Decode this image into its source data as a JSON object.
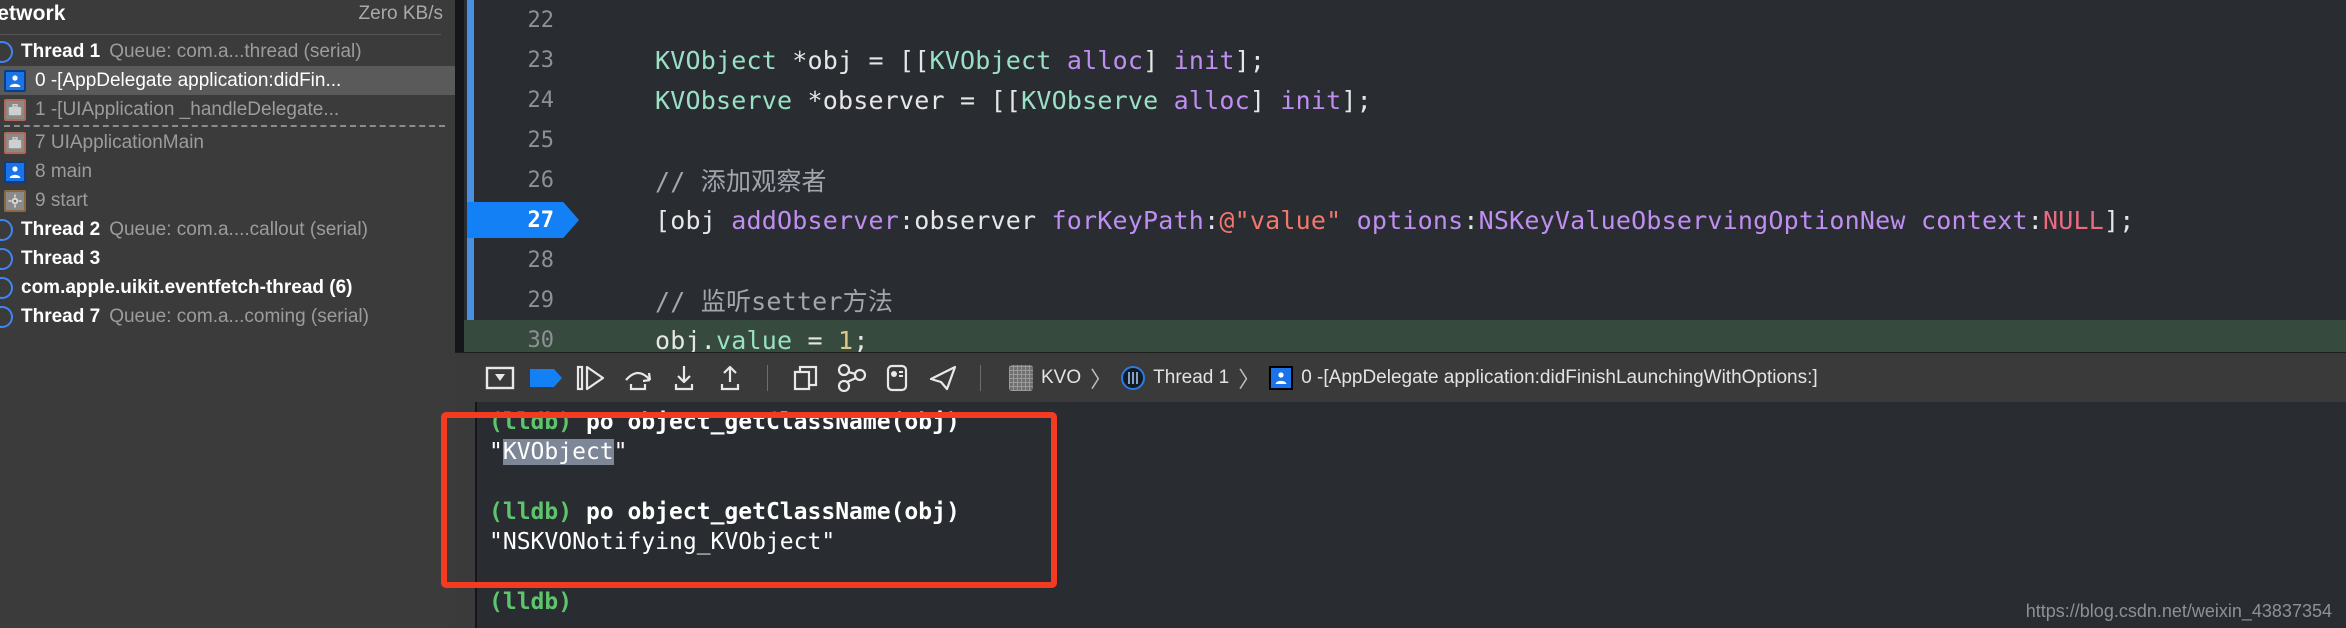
{
  "sidebar": {
    "header": {
      "title": "Network",
      "rate": "Zero KB/s"
    },
    "rows": [
      {
        "kind": "thread",
        "icon": "thread-disclosure-icon",
        "label": "Thread 1",
        "queue": "Queue: com.a...thread (serial)",
        "selected": false,
        "dashed_after": false
      },
      {
        "kind": "frame",
        "icon": "user-frame-icon",
        "label": "0 -[AppDelegate application:didFin...",
        "queue": "",
        "selected": true,
        "dashed_after": false
      },
      {
        "kind": "frame",
        "icon": "system-frame-icon",
        "label": "1 -[UIApplication _handleDelegate...",
        "queue": "",
        "selected": false,
        "dashed_after": true
      },
      {
        "kind": "frame",
        "icon": "system-frame-icon",
        "label": "7 UIApplicationMain",
        "queue": "",
        "selected": false,
        "dashed_after": false
      },
      {
        "kind": "frame",
        "icon": "user-frame-icon",
        "label": "8 main",
        "queue": "",
        "selected": false,
        "dashed_after": false
      },
      {
        "kind": "frame",
        "icon": "kernel-frame-icon",
        "label": "9 start",
        "queue": "",
        "selected": false,
        "dashed_after": false
      },
      {
        "kind": "thread",
        "icon": "thread-disclosure-icon",
        "label": "Thread 2",
        "queue": "Queue: com.a....callout (serial)",
        "selected": false,
        "dashed_after": false
      },
      {
        "kind": "thread",
        "icon": "thread-disclosure-icon",
        "label": "Thread 3",
        "queue": "",
        "selected": false,
        "dashed_after": false
      },
      {
        "kind": "thread",
        "icon": "thread-disclosure-icon",
        "label": "com.apple.uikit.eventfetch-thread (6)",
        "queue": "",
        "selected": false,
        "dashed_after": false
      },
      {
        "kind": "thread",
        "icon": "thread-disclosure-icon",
        "label": "Thread 7",
        "queue": "Queue: com.a...coming (serial)",
        "selected": false,
        "dashed_after": false
      }
    ]
  },
  "editor": {
    "lines": [
      {
        "num": "22",
        "current": false,
        "exec": false,
        "tokens": []
      },
      {
        "num": "23",
        "current": false,
        "exec": false,
        "tokens": [
          {
            "t": "    ",
            "c": "tok-plain"
          },
          {
            "t": "KVObject",
            "c": "tok-type"
          },
          {
            "t": " *obj = [[",
            "c": "tok-plain"
          },
          {
            "t": "KVObject",
            "c": "tok-type"
          },
          {
            "t": " ",
            "c": "tok-plain"
          },
          {
            "t": "alloc",
            "c": "tok-sel"
          },
          {
            "t": "] ",
            "c": "tok-plain"
          },
          {
            "t": "init",
            "c": "tok-sel"
          },
          {
            "t": "];",
            "c": "tok-plain"
          }
        ]
      },
      {
        "num": "24",
        "current": false,
        "exec": false,
        "tokens": [
          {
            "t": "    ",
            "c": "tok-plain"
          },
          {
            "t": "KVObserve",
            "c": "tok-type"
          },
          {
            "t": " *observer = [[",
            "c": "tok-plain"
          },
          {
            "t": "KVObserve",
            "c": "tok-type"
          },
          {
            "t": " ",
            "c": "tok-plain"
          },
          {
            "t": "alloc",
            "c": "tok-sel"
          },
          {
            "t": "] ",
            "c": "tok-plain"
          },
          {
            "t": "init",
            "c": "tok-sel"
          },
          {
            "t": "];",
            "c": "tok-plain"
          }
        ]
      },
      {
        "num": "25",
        "current": false,
        "exec": false,
        "tokens": []
      },
      {
        "num": "26",
        "current": false,
        "exec": false,
        "tokens": [
          {
            "t": "    // 添加观察者",
            "c": "tok-comment"
          }
        ]
      },
      {
        "num": "27",
        "current": true,
        "exec": false,
        "tokens": [
          {
            "t": "    [obj ",
            "c": "tok-plain"
          },
          {
            "t": "addObserver",
            "c": "tok-sel"
          },
          {
            "t": ":observer ",
            "c": "tok-plain"
          },
          {
            "t": "forKeyPath",
            "c": "tok-sel"
          },
          {
            "t": ":",
            "c": "tok-plain"
          },
          {
            "t": "@\"value\"",
            "c": "tok-str"
          },
          {
            "t": " ",
            "c": "tok-plain"
          },
          {
            "t": "options",
            "c": "tok-sel"
          },
          {
            "t": ":",
            "c": "tok-plain"
          },
          {
            "t": "NSKeyValueObservingOptionNew",
            "c": "tok-sel"
          },
          {
            "t": " ",
            "c": "tok-plain"
          },
          {
            "t": "context",
            "c": "tok-sel"
          },
          {
            "t": ":",
            "c": "tok-plain"
          },
          {
            "t": "NULL",
            "c": "tok-const"
          },
          {
            "t": "];",
            "c": "tok-plain"
          }
        ]
      },
      {
        "num": "28",
        "current": false,
        "exec": false,
        "tokens": []
      },
      {
        "num": "29",
        "current": false,
        "exec": false,
        "tokens": [
          {
            "t": "    // 监听setter方法",
            "c": "tok-comment"
          }
        ]
      },
      {
        "num": "30",
        "current": false,
        "exec": true,
        "tokens": [
          {
            "t": "    obj.",
            "c": "tok-plain"
          },
          {
            "t": "value",
            "c": "tok-prop"
          },
          {
            "t": " = ",
            "c": "tok-plain"
          },
          {
            "t": "1",
            "c": "tok-num"
          },
          {
            "t": ";",
            "c": "tok-plain"
          }
        ]
      }
    ]
  },
  "debug_bar": {
    "buttons": [
      {
        "name": "hide-debug-area-button",
        "icon": "hide-debug-area-icon"
      },
      {
        "name": "deactivate-breakpoints-button",
        "icon": "breakpoint-icon"
      },
      {
        "name": "continue-button",
        "icon": "continue-program-icon"
      },
      {
        "name": "step-over-button",
        "icon": "step-over-icon"
      },
      {
        "name": "step-into-button",
        "icon": "step-into-icon"
      },
      {
        "name": "step-out-button",
        "icon": "step-out-icon"
      },
      {
        "name": "debug-view-hierarchy-button",
        "icon": "view-hierarchy-icon"
      },
      {
        "name": "debug-memory-graph-button",
        "icon": "memory-graph-icon"
      },
      {
        "name": "environment-overrides-button",
        "icon": "environment-overrides-icon"
      },
      {
        "name": "simulate-location-button",
        "icon": "location-arrow-icon"
      }
    ],
    "breadcrumb": [
      {
        "icon": "project-icon",
        "label": "KVO"
      },
      {
        "icon": "thread-icon",
        "label": "Thread 1"
      },
      {
        "icon": "person-frame-icon",
        "label": "0 -[AppDelegate application:didFinishLaunchingWithOptions:]"
      }
    ]
  },
  "console": {
    "lines": [
      {
        "prompt": "(lldb)",
        "cmd": " po object_getClassName(obj)",
        "out": "",
        "sel": ""
      },
      {
        "prompt": "",
        "cmd": "",
        "out": "\"KVObject\"",
        "sel": "KVObject"
      },
      {
        "prompt": "",
        "cmd": "",
        "out": "",
        "sel": ""
      },
      {
        "prompt": "(lldb)",
        "cmd": " po object_getClassName(obj)",
        "out": "",
        "sel": ""
      },
      {
        "prompt": "",
        "cmd": "",
        "out": "\"NSKVONotifying_KVObject\"",
        "sel": ""
      },
      {
        "prompt": "",
        "cmd": "",
        "out": "",
        "sel": ""
      },
      {
        "prompt": "(lldb)",
        "cmd": "",
        "out": "",
        "sel": ""
      }
    ]
  },
  "watermark": "https://blog.csdn.net/weixin_43837354",
  "colors": {
    "accent_blue": "#1380f5",
    "highlight_red": "#f23b21",
    "exec_green": "#374a3e",
    "lldb_green": "#5ec56c"
  }
}
